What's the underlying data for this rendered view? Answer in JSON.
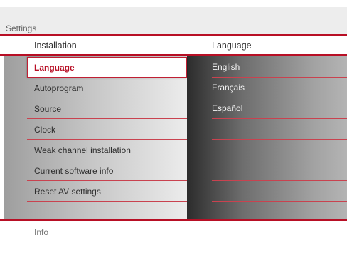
{
  "window": {
    "title": "Settings"
  },
  "columns": {
    "left_header": "Installation",
    "right_header": "Language"
  },
  "menu": {
    "items": [
      {
        "label": "Language",
        "selected": true
      },
      {
        "label": "Autoprogram"
      },
      {
        "label": "Source"
      },
      {
        "label": "Clock"
      },
      {
        "label": "Weak channel installation"
      },
      {
        "label": "Current software info"
      },
      {
        "label": "Reset AV settings"
      }
    ]
  },
  "options": {
    "items": [
      {
        "label": "English"
      },
      {
        "label": "Français"
      },
      {
        "label": "Español"
      },
      {
        "label": ""
      },
      {
        "label": ""
      },
      {
        "label": ""
      },
      {
        "label": ""
      }
    ]
  },
  "footer": {
    "info_label": "Info"
  },
  "colors": {
    "accent": "#b80f25",
    "panel_dark": "#2c2c2c",
    "panel_light": "#ececec"
  }
}
